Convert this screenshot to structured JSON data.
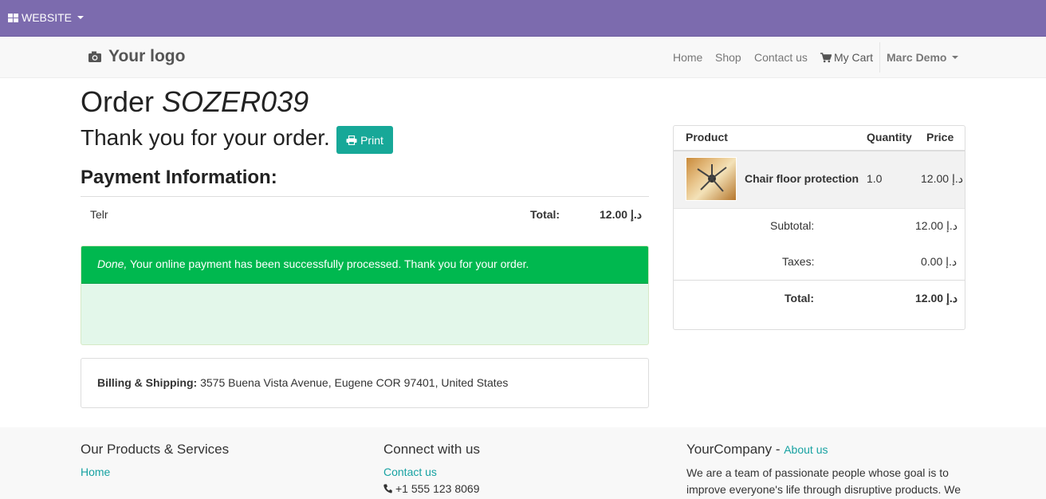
{
  "topbar": {
    "website_label": "WEBSITE"
  },
  "navbar": {
    "logo_text": "Your logo",
    "links": [
      "Home",
      "Shop",
      "Contact us"
    ],
    "cart_label": "My Cart",
    "user_name": "Marc Demo"
  },
  "order": {
    "title_prefix": "Order",
    "order_number": "SOZER039",
    "thanks_text": "Thank you for your order.",
    "print_label": "Print"
  },
  "payment": {
    "title": "Payment Information:",
    "method": "Telr",
    "total_label": "Total:",
    "total_value": "12.00 د.إ"
  },
  "success": {
    "status": "Done,",
    "message": " Your online payment has been successfully processed. Thank you for your order."
  },
  "billing": {
    "label": "Billing & Shipping:",
    "address": " 3575 Buena Vista Avenue, Eugene COR 97401, United States"
  },
  "cart_summary": {
    "headers": {
      "product": "Product",
      "quantity": "Quantity",
      "price": "Price"
    },
    "items": [
      {
        "name": "Chair floor protection",
        "quantity": "1.0",
        "price": "12.00 د.إ"
      }
    ],
    "subtotal_label": "Subtotal:",
    "subtotal_value": "12.00 د.إ",
    "taxes_label": "Taxes:",
    "taxes_value": "0.00 د.إ",
    "total_label": "Total:",
    "total_value": "12.00 د.إ"
  },
  "footer": {
    "products_title": "Our Products & Services",
    "products_link": "Home",
    "connect_title": "Connect with us",
    "contact_link": "Contact us",
    "phone": "+1 555 123 8069",
    "company_name": "YourCompany",
    "company_sep": " - ",
    "about_link": "About us",
    "about_text": "We are a team of passionate people whose goal is to improve everyone's life through disruptive products. We"
  }
}
